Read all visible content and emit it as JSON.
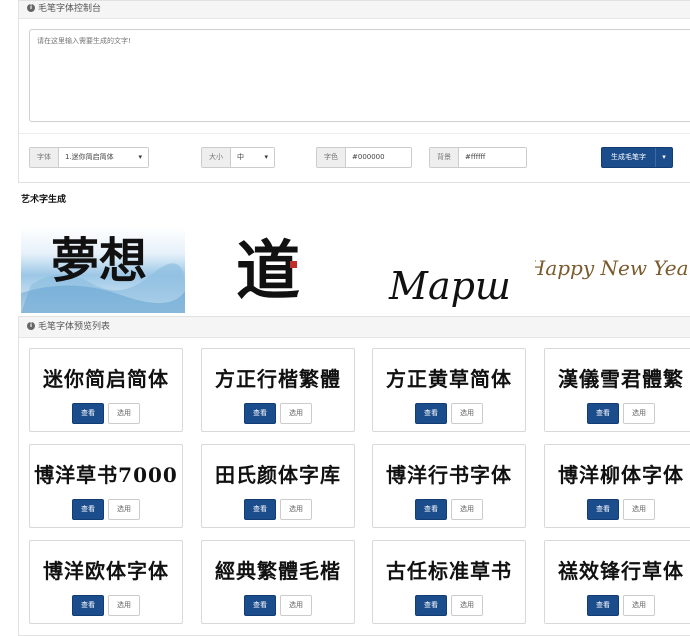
{
  "control_panel": {
    "title": "毛笔字体控制台",
    "textarea_placeholder": "请在这里输入需要生成的文字!",
    "font": {
      "label": "字体",
      "value": "1.迷你简启简体"
    },
    "size": {
      "label": "大小",
      "value": "中"
    },
    "color": {
      "label": "字色",
      "value": "#000000"
    },
    "background": {
      "label": "背景",
      "value": "#ffffff"
    },
    "generate_label": "生成毛笔字"
  },
  "art_section": {
    "title": "艺术字生成",
    "banners": [
      {
        "text": "夢想"
      },
      {
        "text": "道"
      },
      {
        "text": "Марш"
      },
      {
        "text": "Happy New Year"
      }
    ]
  },
  "preview_list": {
    "title": "毛笔字体预览列表",
    "view_label": "查看",
    "use_label": "选用",
    "fonts": [
      {
        "sample": "迷你简启简体"
      },
      {
        "sample": "方正行楷繁體"
      },
      {
        "sample": "方正黄草简体"
      },
      {
        "sample": "漢儀雪君體繁"
      },
      {
        "sample": "博洋草书7000"
      },
      {
        "sample": "田氏颜体字库"
      },
      {
        "sample": "博洋行书字体"
      },
      {
        "sample": "博洋柳体字体"
      },
      {
        "sample": "博洋欧体字体"
      },
      {
        "sample": "經典繁體毛楷"
      },
      {
        "sample": "古任标准草书"
      },
      {
        "sample": "禚效锋行草体"
      }
    ]
  }
}
